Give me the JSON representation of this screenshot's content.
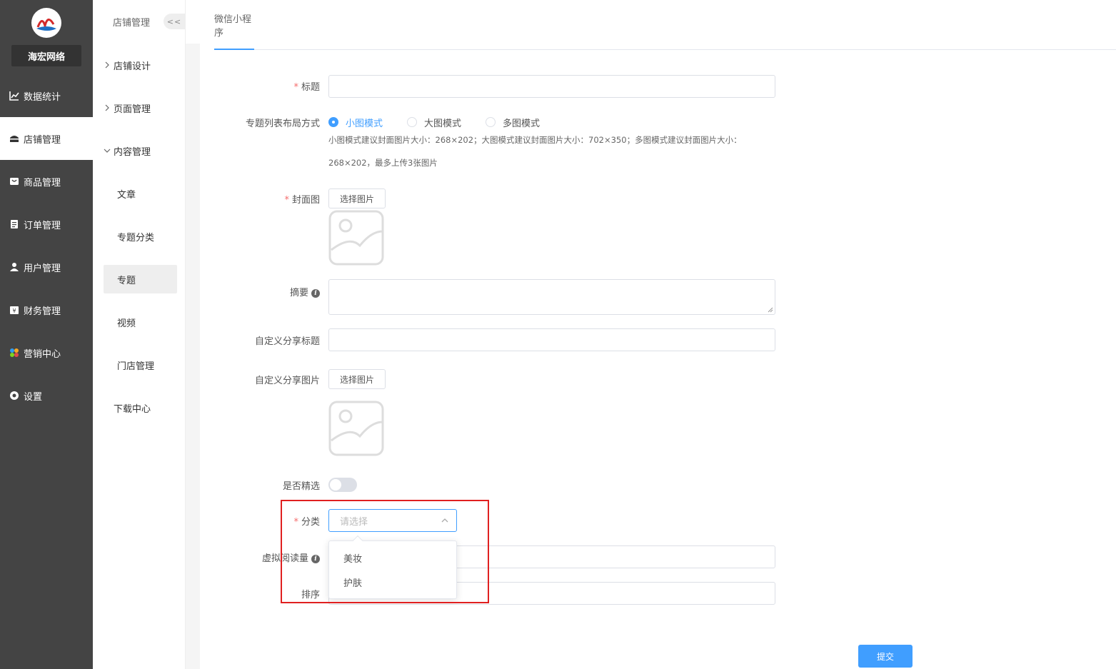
{
  "brand": {
    "name": "海宏网络"
  },
  "sidebar": {
    "items": [
      {
        "label": "数据统计",
        "icon": "chart-icon"
      },
      {
        "label": "店铺管理",
        "icon": "store-icon",
        "active": true
      },
      {
        "label": "商品管理",
        "icon": "goods-icon"
      },
      {
        "label": "订单管理",
        "icon": "order-icon"
      },
      {
        "label": "用户管理",
        "icon": "user-icon"
      },
      {
        "label": "财务管理",
        "icon": "finance-icon"
      },
      {
        "label": "营销中心",
        "icon": "marketing-icon"
      },
      {
        "label": "设置",
        "icon": "settings-icon"
      }
    ]
  },
  "subnav": {
    "title": "店铺管理",
    "collapse_label": "<<",
    "groups": [
      {
        "label": "店铺设计",
        "expanded": false
      },
      {
        "label": "页面管理",
        "expanded": false
      },
      {
        "label": "内容管理",
        "expanded": true
      }
    ],
    "children": [
      "文章",
      "专题分类",
      "专题",
      "视频",
      "门店管理"
    ],
    "active_child": "专题",
    "download": "下载中心"
  },
  "tabs": {
    "active": "微信小程序"
  },
  "form": {
    "title": {
      "label": "标题",
      "required": true,
      "value": ""
    },
    "layout": {
      "label": "专题列表布局方式",
      "options": [
        "小图模式",
        "大图模式",
        "多图模式"
      ],
      "selected": "小图模式",
      "hint_line1": "小图模式建议封面图片大小：268×202；大图模式建议封面图片大小：702×350；多图模式建议封面图片大小：",
      "hint_line2": "268×202，最多上传3张图片"
    },
    "cover": {
      "label": "封面图",
      "required": true,
      "button": "选择图片"
    },
    "summary": {
      "label": "摘要",
      "value": ""
    },
    "share_title": {
      "label": "自定义分享标题",
      "value": ""
    },
    "share_image": {
      "label": "自定义分享图片",
      "button": "选择图片"
    },
    "featured": {
      "label": "是否精选",
      "on": false
    },
    "category": {
      "label": "分类",
      "required": true,
      "placeholder": "请选择",
      "options": [
        "美妆",
        "护肤"
      ]
    },
    "virtual_reads": {
      "label": "虚拟阅读量",
      "value": ""
    },
    "sort": {
      "label": "排序",
      "value": ""
    },
    "submit": "提交"
  },
  "colors": {
    "primary": "#409eff",
    "sidebar_bg": "#444444",
    "highlight": "#e02020",
    "required": "#f56c6c"
  }
}
